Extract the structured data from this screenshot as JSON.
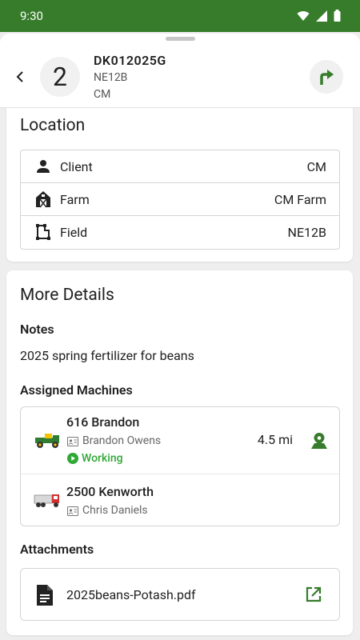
{
  "status_bar": {
    "time": "9:30"
  },
  "header": {
    "sequence": "2",
    "title": "DK012025G",
    "subtitle_field": "NE12B",
    "subtitle_client": "CM"
  },
  "location": {
    "title": "Location",
    "rows": [
      {
        "icon": "person-icon",
        "label": "Client",
        "value": "CM"
      },
      {
        "icon": "barn-icon",
        "label": "Farm",
        "value": "CM Farm"
      },
      {
        "icon": "field-boundary-icon",
        "label": "Field",
        "value": "NE12B"
      }
    ]
  },
  "details": {
    "title": "More Details",
    "notes_label": "Notes",
    "notes_text": "2025 spring fertilizer for beans",
    "machines_label": "Assigned Machines",
    "machines": [
      {
        "name": "616 Brandon",
        "operator": "Brandon Owens",
        "status": "Working",
        "distance": "4.5 mi",
        "icon": "sprayer-icon"
      },
      {
        "name": "2500 Kenworth",
        "operator": "Chris Daniels",
        "icon": "truck-icon"
      }
    ],
    "attachments_label": "Attachments",
    "attachments": [
      {
        "name": "2025beans-Potash.pdf",
        "icon": "document-icon"
      }
    ]
  },
  "colors": {
    "brand_green": "#367c2b",
    "status_green": "#2fa836"
  }
}
